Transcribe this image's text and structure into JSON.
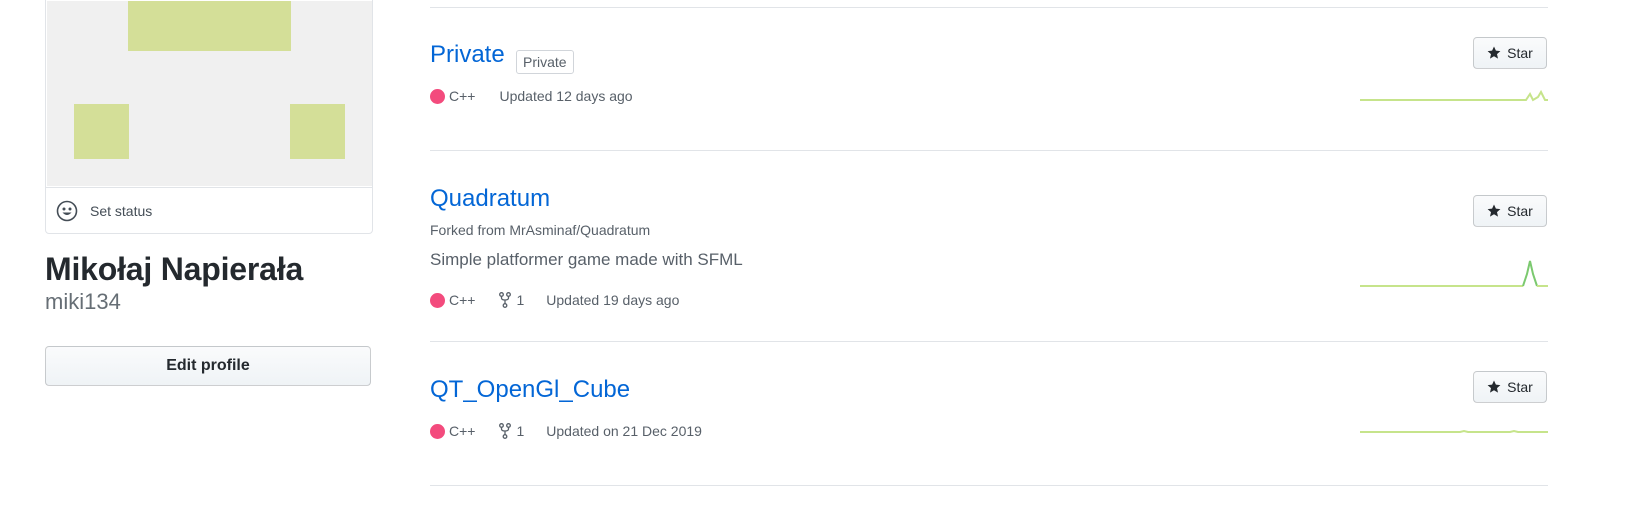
{
  "colors": {
    "link": "#0366d6",
    "cpp_language": "#f34b7d",
    "avatar_pixel": "#d4df98",
    "avatar_bg": "#f0f0f0",
    "sparkline": "#c6e48b",
    "sparkline_peak": "#7bc96f"
  },
  "profile": {
    "set_status_label": "Set status",
    "status_icon": "smiley-icon",
    "full_name": "Mikołaj Napierała",
    "login": "miki134",
    "edit_profile_label": "Edit profile"
  },
  "repos": [
    {
      "name": "Private",
      "visibility_badge": "Private",
      "language": "C++",
      "updated": "Updated 12 days ago",
      "star_label": "Star"
    },
    {
      "name": "Quadratum",
      "fork_prefix": "Forked from",
      "forked_from": "MrAsminaf/Quadratum",
      "description": "Simple platformer game made with SFML",
      "language": "C++",
      "forks": "1",
      "updated": "Updated 19 days ago",
      "star_label": "Star"
    },
    {
      "name": "QT_OpenGl_Cube",
      "language": "C++",
      "forks": "1",
      "updated": "Updated on 21 Dec 2019",
      "star_label": "Star"
    }
  ]
}
